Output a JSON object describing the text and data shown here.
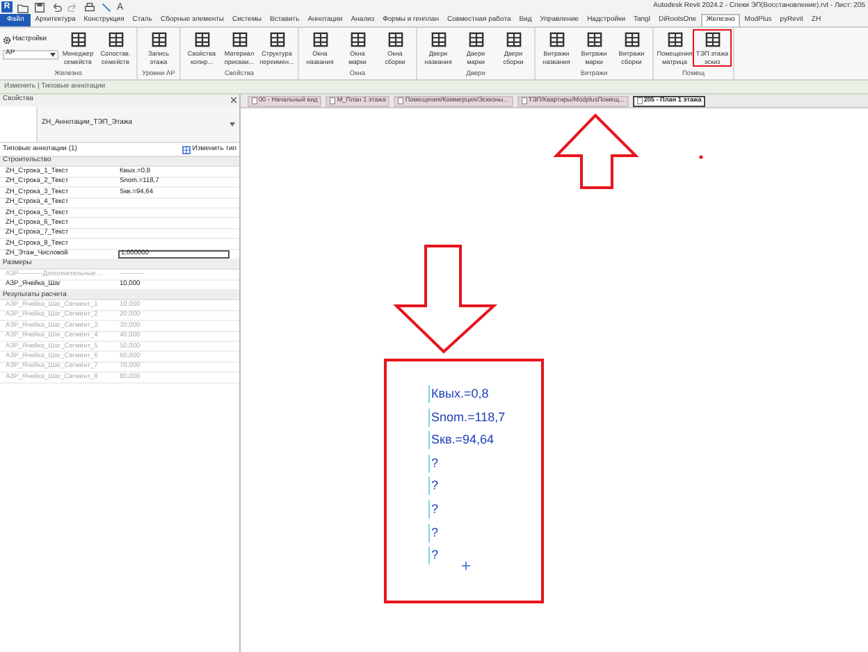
{
  "window": {
    "title": "Autodesk Revit 2024.2 - Спеки ЭП(Восстановление).rvt - Лист: 205",
    "app_logo": "R",
    "toolbar_text": "A"
  },
  "ribbon_tabs": [
    {
      "label": "Файл",
      "selected": false,
      "kind": "file"
    },
    {
      "label": "Архитектура",
      "selected": false,
      "kind": "tab"
    },
    {
      "label": "Конструкция",
      "selected": false,
      "kind": "tab"
    },
    {
      "label": "Сталь",
      "selected": false,
      "kind": "tab"
    },
    {
      "label": "Сборные элементы",
      "selected": false,
      "kind": "tab"
    },
    {
      "label": "Системы",
      "selected": false,
      "kind": "tab"
    },
    {
      "label": "Вставить",
      "selected": false,
      "kind": "tab"
    },
    {
      "label": "Аннотации",
      "selected": false,
      "kind": "tab"
    },
    {
      "label": "Анализ",
      "selected": false,
      "kind": "tab"
    },
    {
      "label": "Формы и генплан",
      "selected": false,
      "kind": "tab"
    },
    {
      "label": "Совместная работа",
      "selected": false,
      "kind": "tab"
    },
    {
      "label": "Вид",
      "selected": false,
      "kind": "tab"
    },
    {
      "label": "Управление",
      "selected": false,
      "kind": "tab"
    },
    {
      "label": "Надстройки",
      "selected": false,
      "kind": "tab"
    },
    {
      "label": "Tangl",
      "selected": false,
      "kind": "tab"
    },
    {
      "label": "DiRootsOne",
      "selected": false,
      "kind": "tab"
    },
    {
      "label": "Железно",
      "selected": true,
      "kind": "tab"
    },
    {
      "label": "ModPlus",
      "selected": false,
      "kind": "tab"
    },
    {
      "label": "pyRevit",
      "selected": false,
      "kind": "tab"
    },
    {
      "label": "ZH",
      "selected": false,
      "kind": "tab"
    }
  ],
  "ribbon_panels": [
    {
      "label": "Железно",
      "items": [
        {
          "kind": "settings",
          "label": "Настройки",
          "value": "АР"
        },
        {
          "kind": "large",
          "lines": [
            "Менеджер",
            "семейств"
          ],
          "highlighted": false
        },
        {
          "kind": "large",
          "lines": [
            "Сопостав.",
            "семейств"
          ],
          "highlighted": false
        }
      ]
    },
    {
      "label": "Уровни АР",
      "items": [
        {
          "kind": "large",
          "lines": [
            "Запись",
            "этажа"
          ],
          "highlighted": false
        }
      ]
    },
    {
      "label": "Свойства",
      "items": [
        {
          "kind": "large",
          "lines": [
            "Свойства",
            "копир..."
          ],
          "highlighted": false
        },
        {
          "kind": "large",
          "lines": [
            "Материал",
            "присваи..."
          ],
          "highlighted": false
        },
        {
          "kind": "large",
          "lines": [
            "Структура",
            "переимен..."
          ],
          "highlighted": false
        }
      ]
    },
    {
      "label": "Окна",
      "items": [
        {
          "kind": "large",
          "lines": [
            "Окна",
            "названия"
          ],
          "highlighted": false
        },
        {
          "kind": "large",
          "lines": [
            "Окна",
            "марки"
          ],
          "highlighted": false
        },
        {
          "kind": "large",
          "lines": [
            "Окна",
            "сборки"
          ],
          "highlighted": false
        }
      ]
    },
    {
      "label": "Двери",
      "items": [
        {
          "kind": "large",
          "lines": [
            "Двери",
            "названия"
          ],
          "highlighted": false
        },
        {
          "kind": "large",
          "lines": [
            "Двери",
            "марки"
          ],
          "highlighted": false
        },
        {
          "kind": "large",
          "lines": [
            "Двери",
            "сборки"
          ],
          "highlighted": false
        }
      ]
    },
    {
      "label": "Витражи",
      "items": [
        {
          "kind": "large",
          "lines": [
            "Витражи",
            "названия"
          ],
          "highlighted": false
        },
        {
          "kind": "large",
          "lines": [
            "Витражи",
            "марки"
          ],
          "highlighted": false
        },
        {
          "kind": "large",
          "lines": [
            "Витражи",
            "сборки"
          ],
          "highlighted": false
        }
      ]
    },
    {
      "label": "Помещ",
      "items": [
        {
          "kind": "large",
          "lines": [
            "Помещения",
            "матрица"
          ],
          "highlighted": false
        },
        {
          "kind": "large",
          "lines": [
            "ТЭП этажа",
            "эскиз"
          ],
          "highlighted": true
        }
      ]
    }
  ],
  "context_bar": "Изменить | Типовые аннотации",
  "properties": {
    "title": "Свойства",
    "type_name": "ZH_Аннотации_ТЭП_Этажа",
    "filter": "Типовые аннотации (1)",
    "edit_type": "Изменить тип",
    "groups": [
      {
        "label": "Строительство",
        "rows": [
          {
            "name": "ZH_Строка_1_Текст",
            "value": "Квых.=0,8",
            "kind": "text",
            "disabled": false
          },
          {
            "name": "ZH_Строка_2_Текст",
            "value": "Snom.=118,7",
            "kind": "text",
            "disabled": false
          },
          {
            "name": "ZH_Строка_3_Текст",
            "value": "Sкв.=94,64",
            "kind": "text",
            "disabled": false
          },
          {
            "name": "ZH_Строка_4_Текст",
            "kind": "text",
            "disabled": false
          },
          {
            "name": "ZH_Строка_5_Текст",
            "kind": "text",
            "disabled": false
          },
          {
            "name": "ZH_Строка_6_Текст",
            "kind": "text",
            "disabled": false
          },
          {
            "name": "ZH_Строка_7_Текст",
            "kind": "text",
            "disabled": false
          },
          {
            "name": "ZH_Строка_8_Текст",
            "kind": "text",
            "disabled": false
          },
          {
            "name": "ZH_Этаж_Числовой",
            "value": "1,000000",
            "kind": "input",
            "disabled": false
          }
        ]
      },
      {
        "label": "Размеры",
        "rows": [
          {
            "name": "АЗР-----------Дополнительные ...",
            "value": "-----------",
            "kind": "text",
            "disabled": true
          },
          {
            "name": "АЗР_Ячейка_Шаг",
            "value": "10,000",
            "kind": "text",
            "disabled": false
          }
        ]
      },
      {
        "label": "Результаты расчета",
        "rows": [
          {
            "name": "АЗР_Ячейка_Шаг_Сегмент_1",
            "value": "10,000",
            "kind": "text",
            "disabled": true
          },
          {
            "name": "АЗР_Ячейка_Шаг_Сегмент_2",
            "value": "20,000",
            "kind": "text",
            "disabled": true
          },
          {
            "name": "АЗР_Ячейка_Шаг_Сегмент_3",
            "value": "30,000",
            "kind": "text",
            "disabled": true
          },
          {
            "name": "АЗР_Ячейка_Шаг_Сегмент_4",
            "value": "40,000",
            "kind": "text",
            "disabled": true
          },
          {
            "name": "АЗР_Ячейка_Шаг_Сегмент_5",
            "value": "50,000",
            "kind": "text",
            "disabled": true
          },
          {
            "name": "АЗР_Ячейка_Шаг_Сегмент_6",
            "value": "60,000",
            "kind": "text",
            "disabled": true
          },
          {
            "name": "АЗР_Ячейка_Шаг_Сегмент_7",
            "value": "70,000",
            "kind": "text",
            "disabled": true
          },
          {
            "name": "АЗР_Ячейка_Шаг_Сегмент_8",
            "value": "80,000",
            "kind": "text",
            "disabled": true
          }
        ]
      }
    ]
  },
  "doc_tabs": [
    {
      "label": "00 - Начальный вид",
      "selected": false
    },
    {
      "label": "М_План 1 этажа",
      "selected": false
    },
    {
      "label": "Помещения/Коммерция/Эскизны...",
      "selected": false
    },
    {
      "label": "ТЭП/Квартиры/ModplusПомещ...",
      "selected": false
    },
    {
      "label": "205 - План 1 этажа",
      "selected": true
    }
  ],
  "canvas": {
    "lines": [
      "Квых.=0,8",
      "Snom.=118,7",
      "Sкв.=94,64",
      "?",
      "?",
      "?",
      "?",
      "?"
    ]
  }
}
